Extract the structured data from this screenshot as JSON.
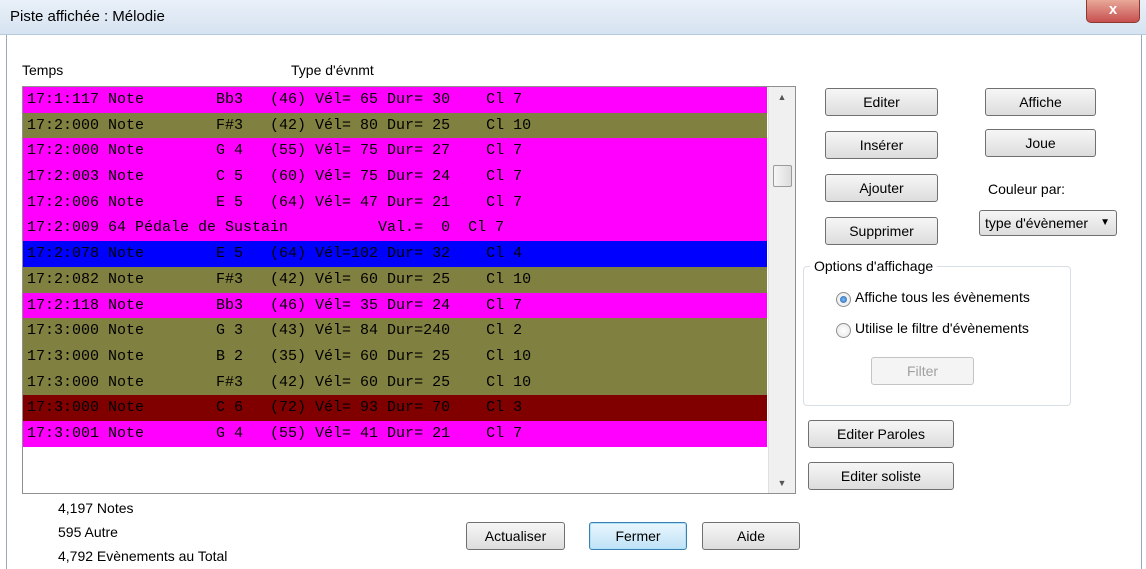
{
  "window": {
    "title": "Piste affichée : Mélodie",
    "close_label": "x"
  },
  "list": {
    "col_time": "Temps",
    "col_type": "Type d'évnmt",
    "rows": [
      {
        "text": "17:1:117 Note        Bb3   (46) Vél= 65 Dur= 30    Cl 7",
        "bg": "#ff00ff",
        "fg": "#000000"
      },
      {
        "text": "17:2:000 Note        F#3   (42) Vél= 80 Dur= 25    Cl 10",
        "bg": "#808040",
        "fg": "#000000"
      },
      {
        "text": "17:2:000 Note        G 4   (55) Vél= 75 Dur= 27    Cl 7",
        "bg": "#ff00ff",
        "fg": "#000000"
      },
      {
        "text": "17:2:003 Note        C 5   (60) Vél= 75 Dur= 24    Cl 7",
        "bg": "#ff00ff",
        "fg": "#000000"
      },
      {
        "text": "17:2:006 Note        E 5   (64) Vél= 47 Dur= 21    Cl 7",
        "bg": "#ff00ff",
        "fg": "#000000"
      },
      {
        "text": "17:2:009 64 Pédale de Sustain          Val.=  0  Cl 7",
        "bg": "#ff00ff",
        "fg": "#000000"
      },
      {
        "text": "17:2:078 Note        E 5   (64) Vél=102 Dur= 32    Cl 4",
        "bg": "#0000ff",
        "fg": "#000000"
      },
      {
        "text": "17:2:082 Note        F#3   (42) Vél= 60 Dur= 25    Cl 10",
        "bg": "#808040",
        "fg": "#000000"
      },
      {
        "text": "17:2:118 Note        Bb3   (46) Vél= 35 Dur= 24    Cl 7",
        "bg": "#ff00ff",
        "fg": "#000000"
      },
      {
        "text": "17:3:000 Note        G 3   (43) Vél= 84 Dur=240    Cl 2",
        "bg": "#808040",
        "fg": "#000000"
      },
      {
        "text": "17:3:000 Note        B 2   (35) Vél= 60 Dur= 25    Cl 10",
        "bg": "#808040",
        "fg": "#000000"
      },
      {
        "text": "17:3:000 Note        F#3   (42) Vél= 60 Dur= 25    Cl 10",
        "bg": "#808040",
        "fg": "#000000"
      },
      {
        "text": "17:3:000 Note        C 6   (72) Vél= 93 Dur= 70    Cl 3",
        "bg": "#800000",
        "fg": "#000000"
      },
      {
        "text": "17:3:001 Note        G 4   (55) Vél= 41 Dur= 21    Cl 7",
        "bg": "#ff00ff",
        "fg": "#000000"
      }
    ]
  },
  "stats": {
    "notes": "4,197 Notes",
    "other": "595 Autre",
    "total": "4,792 Evènements au Total"
  },
  "buttons": {
    "editer": "Editer",
    "inserer": "Insérer",
    "ajouter": "Ajouter",
    "supprimer": "Supprimer",
    "affiche": "Affiche",
    "joue": "Joue",
    "editer_paroles": "Editer Paroles",
    "editer_soliste": "Editer soliste",
    "actualiser": "Actualiser",
    "fermer": "Fermer",
    "aide": "Aide",
    "filter": "Filter"
  },
  "color_by": {
    "label": "Couleur par:",
    "value": "type d'évènemer"
  },
  "display_options": {
    "title": "Options d'affichage",
    "show_all": "Affiche tous les évènements",
    "use_filter": "Utilise le filtre d'évènements",
    "selected": "show_all"
  }
}
